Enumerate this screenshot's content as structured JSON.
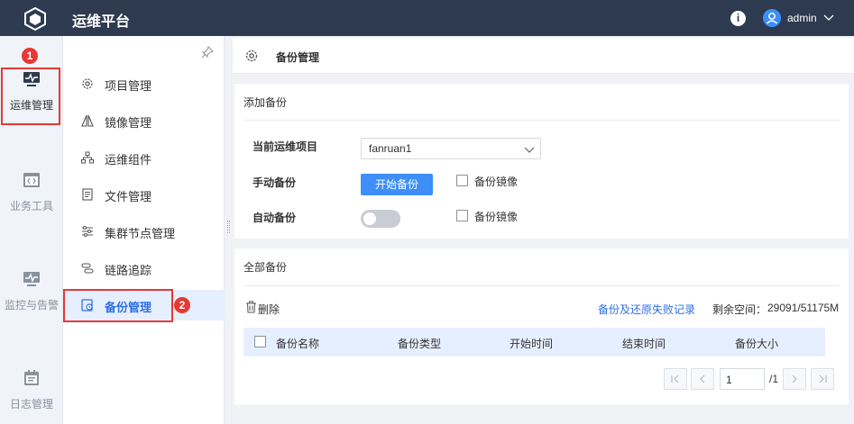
{
  "header": {
    "app_title": "运维平台",
    "info_label": "i",
    "user": "admin"
  },
  "nav_primary": {
    "items": [
      {
        "label": "运维管理",
        "icon": "monitor-pulse-icon",
        "active": true
      },
      {
        "label": "业务工具",
        "icon": "code-window-icon",
        "active": false
      },
      {
        "label": "监控与告警",
        "icon": "monitor-alert-icon",
        "active": false
      },
      {
        "label": "日志管理",
        "icon": "calendar-log-icon",
        "active": false
      }
    ]
  },
  "nav_secondary": {
    "items": [
      {
        "label": "项目管理",
        "icon": "gear-icon"
      },
      {
        "label": "镜像管理",
        "icon": "mirror-icon"
      },
      {
        "label": "运维组件",
        "icon": "component-tree-icon"
      },
      {
        "label": "文件管理",
        "icon": "file-icon"
      },
      {
        "label": "集群节点管理",
        "icon": "sliders-icon"
      },
      {
        "label": "链路追踪",
        "icon": "link-trace-icon"
      },
      {
        "label": "备份管理",
        "icon": "backup-icon",
        "active": true
      }
    ]
  },
  "annotations": {
    "marker1": "1",
    "marker2": "2"
  },
  "breadcrumb": {
    "title": "备份管理"
  },
  "add_backup": {
    "title": "添加备份",
    "project_label": "当前运维项目",
    "project_value": "fanruan1",
    "manual_label": "手动备份",
    "start_button": "开始备份",
    "mirror_checkbox_label": "备份镜像",
    "auto_label": "自动备份",
    "auto_enabled": false,
    "auto_mirror_checkbox_label": "备份镜像"
  },
  "all_backups": {
    "title": "全部备份",
    "delete_label": "删除",
    "fail_log_link": "备份及还原失败记录",
    "space_label": "剩余空间：",
    "space_value": "29091/51175M",
    "columns": [
      "备份名称",
      "备份类型",
      "开始时间",
      "结束时间",
      "备份大小"
    ],
    "rows": []
  },
  "pagination": {
    "current": "1",
    "total": "/1"
  },
  "colors": {
    "header_bg": "#2e3a4f",
    "primary": "#3d8ef8",
    "active_text": "#2f6fe4",
    "marker": "#e53935"
  }
}
